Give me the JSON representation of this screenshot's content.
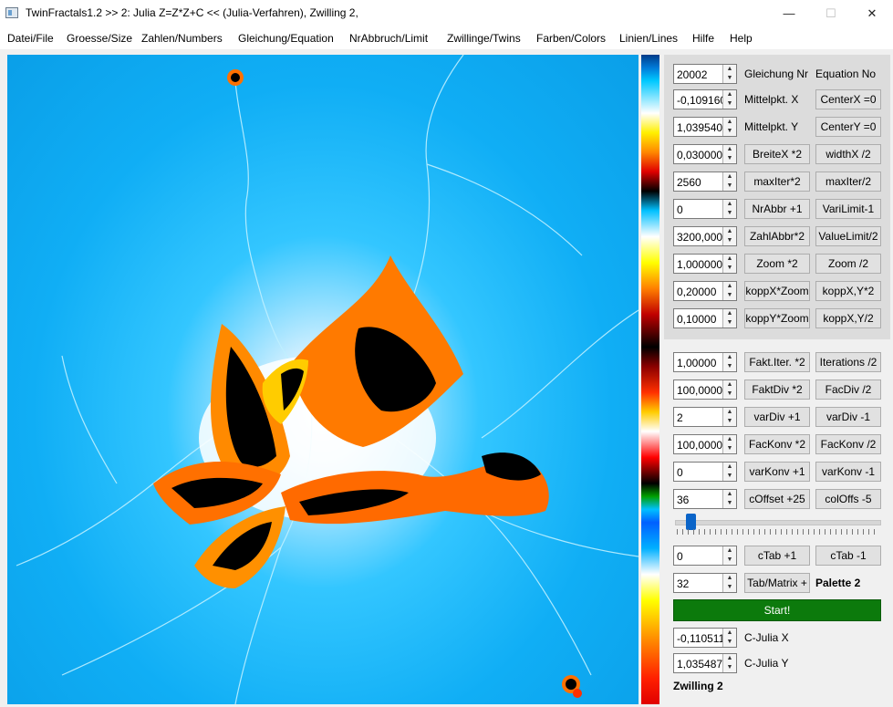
{
  "window": {
    "title": "TwinFractals1.2 >> 2: Julia Z=Z*Z+C << (Julia-Verfahren), Zwilling 2,",
    "min": "—",
    "max": "☐",
    "close": "✕"
  },
  "menu": [
    "Datei/File",
    "Groesse/Size",
    "Zahlen/Numbers",
    "Gleichung/Equation",
    "NrAbbruch/Limit",
    "Zwillinge/Twins",
    "Farben/Colors",
    "Linien/Lines",
    "Hilfe",
    "Help"
  ],
  "rows": [
    {
      "value": "20002",
      "left": "Gleichung Nr",
      "right": "Equation No",
      "left_is_label": true,
      "right_is_label": true
    },
    {
      "value": "-0,1091600",
      "left": "Mittelpkt. X",
      "right": "CenterX =0",
      "left_is_label": true
    },
    {
      "value": "1,03954060",
      "left": "Mittelpkt. Y",
      "right": "CenterY =0",
      "left_is_label": true
    },
    {
      "value": "0,0300000",
      "left": "BreiteX *2",
      "right": "widthX /2"
    },
    {
      "value": "2560",
      "left": "maxIter*2",
      "right": "maxIter/2"
    },
    {
      "value": "0",
      "left": "NrAbbr +1",
      "right": "VariLimit-1"
    },
    {
      "value": "3200,0000",
      "left": "ZahlAbbr*2",
      "right": "ValueLimit/2"
    },
    {
      "value": "1,0000000",
      "left": "Zoom *2",
      "right": "Zoom /2"
    },
    {
      "value": "0,20000",
      "left": "koppX*Zoom",
      "right": "koppX,Y*2"
    },
    {
      "value": "0,10000",
      "left": "koppY*Zoom",
      "right": "koppX,Y/2"
    },
    {
      "value": "1,00000",
      "left": "Fakt.Iter. *2",
      "right": "Iterations /2"
    },
    {
      "value": "100,00000",
      "left": "FaktDiv *2",
      "right": "FacDiv /2"
    },
    {
      "value": "2",
      "left": "varDiv +1",
      "right": "varDiv -1"
    },
    {
      "value": "100,00000",
      "left": "FacKonv *2",
      "right": "FacKonv /2"
    },
    {
      "value": "0",
      "left": "varKonv +1",
      "right": "varKonv -1"
    },
    {
      "value": "36",
      "left": "cOffset +25",
      "right": "colOffs -5"
    }
  ],
  "slider": {
    "level": 0.06
  },
  "ctab": {
    "value": "0",
    "left": "cTab +1",
    "right": "cTab -1"
  },
  "palette": {
    "value": "32",
    "left": "Tab/Matrix +",
    "label": "Palette 2"
  },
  "start_label": "Start!",
  "cjulia_x": {
    "value": "-0,1105110",
    "label": "C-Julia X"
  },
  "cjulia_y": {
    "value": "1,03548740",
    "label": "C-Julia Y"
  },
  "twin_label": "Zwilling 2"
}
